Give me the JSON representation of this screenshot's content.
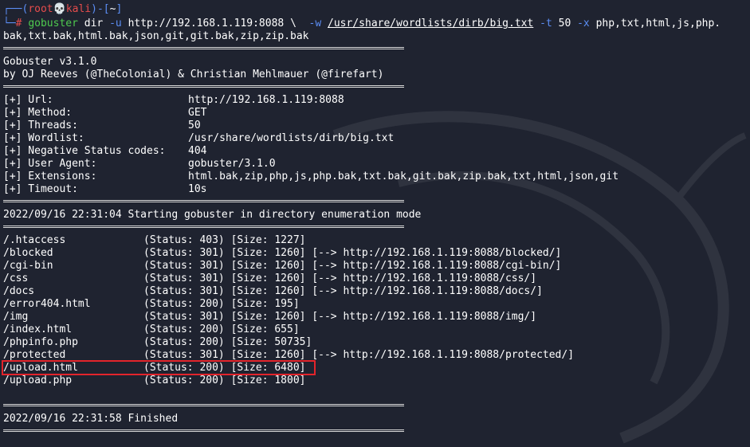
{
  "prompt": {
    "corner_top": "┌──(",
    "user": "root",
    "skull": "💀",
    "host": "kali",
    "mid": ")-[",
    "dir": "~",
    "end": "]",
    "corner_bottom": "└─",
    "hash": "#"
  },
  "command": {
    "tool": "gobuster",
    "mode": "dir",
    "u_flag": "-u",
    "url": "http://192.168.1.119:8088",
    "cont": "\\",
    "w_flag": "-w",
    "wordlist": "/usr/share/wordlists/dirb/big.txt",
    "t_flag": "-t",
    "threads": "50",
    "x_flag": "-x",
    "ext_line1": "php,txt,html,js,php.",
    "ext_line2": "bak,txt.bak,html.bak,json,git,git.bak,zip,zip.bak"
  },
  "banner": {
    "version": "Gobuster v3.1.0",
    "authors": "by OJ Reeves (@TheColonial) & Christian Mehlmauer (@firefart)"
  },
  "config": [
    {
      "label": "[+] Url:",
      "value": "http://192.168.1.119:8088"
    },
    {
      "label": "[+] Method:",
      "value": "GET"
    },
    {
      "label": "[+] Threads:",
      "value": "50"
    },
    {
      "label": "[+] Wordlist:",
      "value": "/usr/share/wordlists/dirb/big.txt"
    },
    {
      "label": "[+] Negative Status codes:",
      "value": "404"
    },
    {
      "label": "[+] User Agent:",
      "value": "gobuster/3.1.0"
    },
    {
      "label": "[+] Extensions:",
      "value": "html.bak,zip,php,js,php.bak,txt.bak,git.bak,zip.bak,txt,html,json,git"
    },
    {
      "label": "[+] Timeout:",
      "value": "10s"
    }
  ],
  "start_message": "2022/09/16 22:31:04 Starting gobuster in directory enumeration mode",
  "results": [
    {
      "path": "/.htaccess",
      "info": "(Status: 403) [Size: 1227]"
    },
    {
      "path": "/blocked",
      "info": "(Status: 301) [Size: 1260] [--> http://192.168.1.119:8088/blocked/]"
    },
    {
      "path": "/cgi-bin",
      "info": "(Status: 301) [Size: 1260] [--> http://192.168.1.119:8088/cgi-bin/]"
    },
    {
      "path": "/css",
      "info": "(Status: 301) [Size: 1260] [--> http://192.168.1.119:8088/css/]"
    },
    {
      "path": "/docs",
      "info": "(Status: 301) [Size: 1260] [--> http://192.168.1.119:8088/docs/]"
    },
    {
      "path": "/error404.html",
      "info": "(Status: 200) [Size: 195]"
    },
    {
      "path": "/img",
      "info": "(Status: 301) [Size: 1260] [--> http://192.168.1.119:8088/img/]"
    },
    {
      "path": "/index.html",
      "info": "(Status: 200) [Size: 655]"
    },
    {
      "path": "/phpinfo.php",
      "info": "(Status: 200) [Size: 50735]"
    },
    {
      "path": "/protected",
      "info": "(Status: 301) [Size: 1260] [--> http://192.168.1.119:8088/protected/]"
    },
    {
      "path": "/upload.html",
      "info": "(Status: 200) [Size: 6480]"
    },
    {
      "path": "/upload.php",
      "info": "(Status: 200) [Size: 1800]"
    }
  ],
  "finish_message": "2022/09/16 22:31:58 Finished",
  "colors": {
    "background": "#1f2330",
    "prompt_blue": "#5c8ef5",
    "prompt_red": "#e64c4c",
    "command_green": "#4ec94e",
    "highlight_red": "#e3242b"
  }
}
